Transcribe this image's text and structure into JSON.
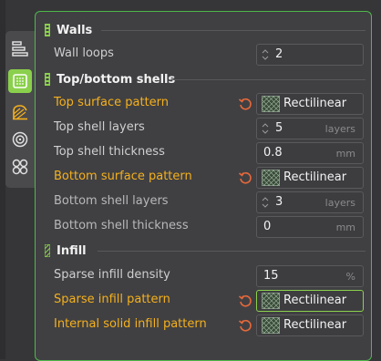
{
  "sidebar": {
    "tabs": [
      {
        "name": "quality-tab",
        "icon": "layers-icon"
      },
      {
        "name": "strength-tab",
        "icon": "infill-grid-icon",
        "active": true
      },
      {
        "name": "support-tab",
        "icon": "support-icon"
      },
      {
        "name": "others-tab",
        "icon": "target-icon"
      },
      {
        "name": "multimaterial-tab",
        "icon": "clover-icon"
      }
    ]
  },
  "sections": {
    "walls": {
      "title": "Walls"
    },
    "top_bottom": {
      "title": "Top/bottom shells"
    },
    "infill": {
      "title": "Infill"
    }
  },
  "settings": {
    "wall_loops": {
      "label": "Wall loops",
      "value": "2"
    },
    "top_surface_pattern": {
      "label": "Top surface pattern",
      "value": "Rectilinear"
    },
    "top_shell_layers": {
      "label": "Top shell layers",
      "value": "5",
      "unit": "layers"
    },
    "top_shell_thickness": {
      "label": "Top shell thickness",
      "value": "0.8",
      "unit": "mm"
    },
    "bottom_surface_pattern": {
      "label": "Bottom surface pattern",
      "value": "Rectilinear"
    },
    "bottom_shell_layers": {
      "label": "Bottom shell layers",
      "value": "3",
      "unit": "layers"
    },
    "bottom_shell_thickness": {
      "label": "Bottom shell thickness",
      "value": "0",
      "unit": "mm"
    },
    "sparse_infill_density": {
      "label": "Sparse infill density",
      "value": "15",
      "unit": "%"
    },
    "sparse_infill_pattern": {
      "label": "Sparse infill pattern",
      "value": "Rectilinear"
    },
    "internal_solid_infill_pattern": {
      "label": "Internal solid infill pattern",
      "value": "Rectilinear"
    }
  },
  "colors": {
    "accent": "#8bd04c",
    "modified": "#f5b01c",
    "reset": "#e8693a",
    "panel_border": "#4fb84b"
  }
}
